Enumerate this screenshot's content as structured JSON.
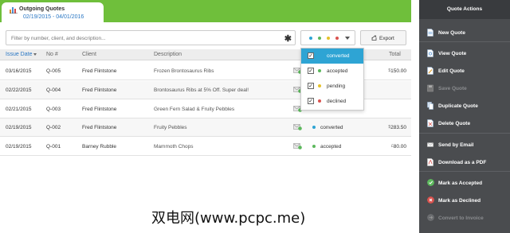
{
  "tab": {
    "title": "Outgoing Quotes",
    "date_range": "02/19/2015 - 04/01/2016"
  },
  "filter": {
    "placeholder": "Filter by number, client, and description...",
    "clear_symbol": "✱"
  },
  "status_colors": {
    "converted": "#2ea4d4",
    "accepted": "#5cb85c",
    "pending": "#e6c229",
    "declined": "#d9534f"
  },
  "export": {
    "label": "Export",
    "icon": "export-icon"
  },
  "table": {
    "headers": {
      "issue_date": "Issue Date",
      "no": "No #",
      "client": "Client",
      "description": "Description",
      "total": "Total"
    },
    "rows": [
      {
        "date": "03/16/2015",
        "no": "Q-005",
        "client": "Fred Flintstone",
        "description": "Frozen Brontosaurus Ribs",
        "status": "",
        "currency": "$",
        "total": "150.00"
      },
      {
        "date": "02/22/2015",
        "no": "Q-004",
        "client": "Fred Flintstone",
        "description": "Brontosaurus Ribs at 5% Off. Super deal!",
        "status": "",
        "currency": "$",
        "total": ""
      },
      {
        "date": "02/21/2015",
        "no": "Q-003",
        "client": "Fred Flintstone",
        "description": "Green Fern Salad & Fruity Pebbles",
        "status": "",
        "currency": "$",
        "total": ""
      },
      {
        "date": "02/19/2015",
        "no": "Q-002",
        "client": "Fred Flintstone",
        "description": "Fruity Pebbles",
        "status": "converted",
        "currency": "$",
        "total": "283.50"
      },
      {
        "date": "02/19/2015",
        "no": "Q-001",
        "client": "Barney Rubble",
        "description": "Mammoth Chops",
        "status": "accepted",
        "currency": "£",
        "total": "80.00"
      }
    ]
  },
  "status_dropdown": {
    "options": [
      {
        "label": "converted",
        "checked": true,
        "checkmark": "✓"
      },
      {
        "label": "accepted",
        "checked": true,
        "checkmark": "✓"
      },
      {
        "label": "pending",
        "checked": true,
        "checkmark": "✓"
      },
      {
        "label": "declined",
        "checked": true,
        "checkmark": "✓"
      }
    ]
  },
  "sidebar": {
    "title": "Quote Actions",
    "items": [
      {
        "label": "New Quote",
        "icon": "new-document-icon",
        "enabled": true
      },
      {
        "label": "View Quote",
        "icon": "view-document-icon",
        "enabled": true
      },
      {
        "label": "Edit Quote",
        "icon": "edit-document-icon",
        "enabled": true
      },
      {
        "label": "Save Quote",
        "icon": "save-icon",
        "enabled": false
      },
      {
        "label": "Duplicate Quote",
        "icon": "duplicate-icon",
        "enabled": true
      },
      {
        "label": "Delete Quote",
        "icon": "delete-document-icon",
        "enabled": true
      },
      {
        "label": "Send by Email",
        "icon": "email-icon",
        "enabled": true
      },
      {
        "label": "Download as a PDF",
        "icon": "pdf-icon",
        "enabled": true
      },
      {
        "label": "Mark as Accepted",
        "icon": "check-circle-icon",
        "enabled": true
      },
      {
        "label": "Mark as Declined",
        "icon": "x-circle-icon",
        "enabled": true
      },
      {
        "label": "Convert to Invoice",
        "icon": "convert-icon",
        "enabled": false
      }
    ]
  },
  "watermark": "双电网(www.pcpc.me)"
}
